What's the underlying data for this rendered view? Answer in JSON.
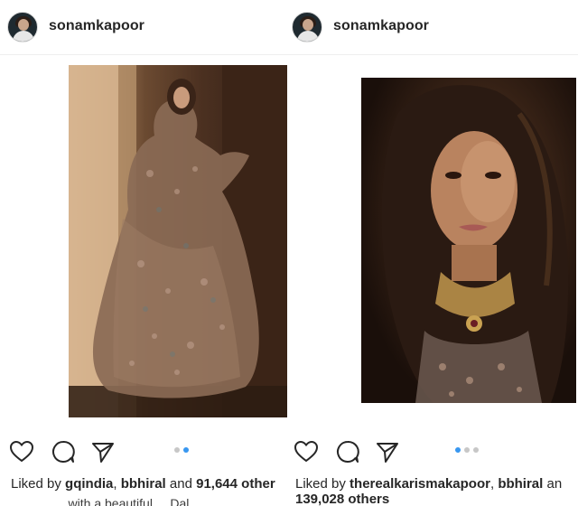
{
  "posts": [
    {
      "username": "sonamkapoor",
      "likes": {
        "prefix": "Liked by ",
        "user1": "gqindia",
        "sep": ", ",
        "user2": "bbhiral",
        "and": " and ",
        "others": "91,644 other"
      },
      "caption_peek": "... with a beautiful ... Dal...",
      "carousel": {
        "count": 2,
        "active": 1
      }
    },
    {
      "username": "sonamkapoor",
      "likes": {
        "prefix": "Liked by ",
        "user1": "therealkarismakapoor",
        "sep": ", ",
        "user2": "bbhiral",
        "and": " an",
        "others": "139,028 others"
      },
      "carousel": {
        "count": 3,
        "active": 0
      }
    }
  ],
  "icons": [
    "heart-icon",
    "comment-icon",
    "share-icon"
  ],
  "colors": {
    "accent": "#3897f0",
    "text": "#262626",
    "dot_inactive": "#c7c7c7"
  }
}
